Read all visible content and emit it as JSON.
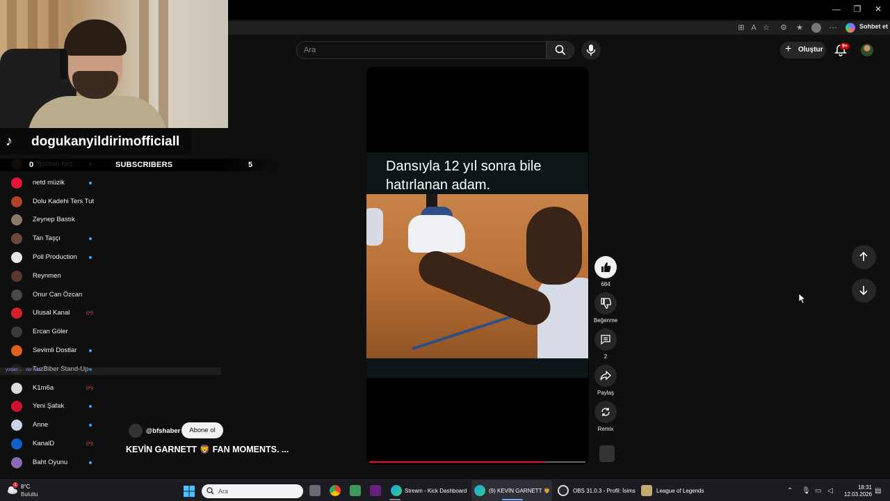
{
  "window": {
    "controls": [
      "—",
      "❐",
      "✕"
    ]
  },
  "browser": {
    "copilot_label": "Sohbet et"
  },
  "youtube_header": {
    "search_placeholder": "Ara",
    "create_label": "Oluştur",
    "notifications_badge": "9+"
  },
  "stream_overlay": {
    "tiktok_handle": "dogukanyildirimofficiall",
    "subscribers_prefix": "0",
    "subscribers_label": "SUBSCRIBERS",
    "subscribers_count": "5",
    "chat_snippet": "yoldan ... : Abi hadi"
  },
  "sidebar": {
    "items": [
      {
        "label": "Oğuzhan Koç",
        "indicator": "dot",
        "color": "#7a5a48"
      },
      {
        "label": "netd müzik",
        "indicator": "dot",
        "color": "#e0143c"
      },
      {
        "label": "Dolu Kadehi Ters Tut",
        "indicator": "none",
        "color": "#b0442a"
      },
      {
        "label": "Zeynep Bastık",
        "indicator": "none",
        "color": "#8a7a6a"
      },
      {
        "label": "Tan Taşçı",
        "indicator": "dot",
        "color": "#6a4a3a"
      },
      {
        "label": "Poll Production",
        "indicator": "dot",
        "color": "#e8e8e8"
      },
      {
        "label": "Reynmen",
        "indicator": "none",
        "color": "#5a3a30"
      },
      {
        "label": "Onur Can Özcan",
        "indicator": "none",
        "color": "#4a4a4a"
      },
      {
        "label": "Ulusal Kanal",
        "indicator": "live",
        "color": "#d4202a"
      },
      {
        "label": "Ercan Göler",
        "indicator": "none",
        "color": "#3a3a3a"
      },
      {
        "label": "Sevimli Dostlar",
        "indicator": "dot",
        "color": "#e06020"
      },
      {
        "label": "TuzBiber Stand-Up",
        "indicator": "dot",
        "color": "#202020"
      },
      {
        "label": "K1m6a",
        "indicator": "live",
        "color": "#dcdcdc"
      },
      {
        "label": "Yeni Şafak",
        "indicator": "dot",
        "color": "#d01030"
      },
      {
        "label": "Anne",
        "indicator": "dot",
        "color": "#c8d4e8"
      },
      {
        "label": "KanalD",
        "indicator": "live",
        "color": "#1060c8"
      },
      {
        "label": "Baht Oyunu",
        "indicator": "dot",
        "color": "#8a6ab8"
      }
    ]
  },
  "short": {
    "caption": "Dansıyla 12 yıl sonra bile hatırlanan adam.",
    "channel_handle": "@bfshaber",
    "subscribe_label": "Abone ol",
    "title": "KEVİN GARNETT 🦁 FAN MOMENTS. ...",
    "progress": 0.81
  },
  "actions": {
    "like_count": "684",
    "dislike_label": "Beğenme",
    "comment_count": "2",
    "share_label": "Paylaş",
    "remix_label": "Remix"
  },
  "taskbar": {
    "weather_temp": "8°C",
    "weather_desc": "Bulutlu",
    "weather_alert": "1",
    "search_placeholder": "Ara",
    "apps": [
      {
        "label": "Stream - Kick Dashboard"
      },
      {
        "label": "(9) KEVİN GARNETT 🦁"
      },
      {
        "label": "OBS 31.0.3 - Profil: İsims"
      },
      {
        "label": "League of Legends"
      }
    ],
    "time": "18:31",
    "date": "12.03.2026"
  }
}
